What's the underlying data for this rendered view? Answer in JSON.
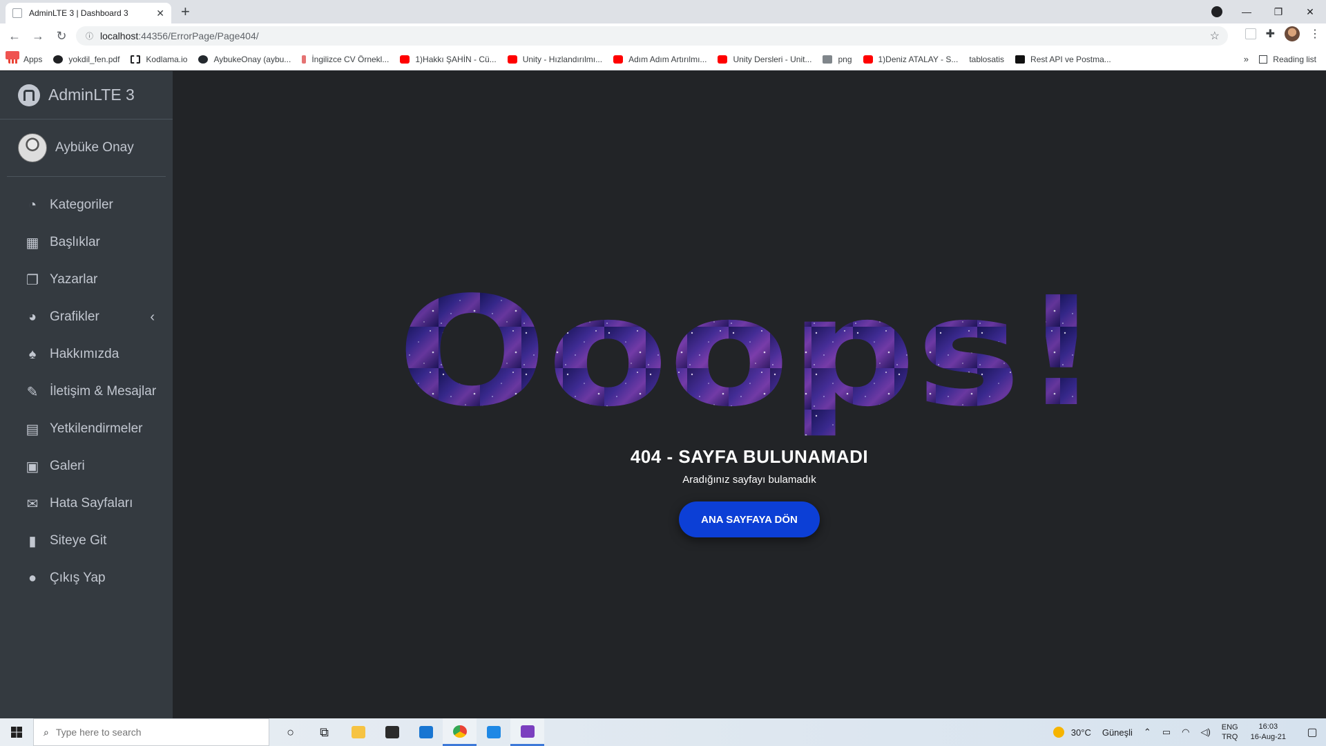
{
  "browser": {
    "tab_title": "AdminLTE 3 | Dashboard 3",
    "tab_close": "✕",
    "new_tab": "+",
    "url_host": "localhost",
    "url_path": ":44356/ErrorPage/Page404/",
    "window_controls": {
      "minimize": "—",
      "restore": "❐",
      "close": "✕"
    },
    "bookmarks": [
      {
        "label": "Apps",
        "icon": "apps-grid-icon"
      },
      {
        "label": "yokdil_fen.pdf",
        "icon": "pdf-icon"
      },
      {
        "label": "Kodlama.io",
        "icon": "kodlama-icon"
      },
      {
        "label": "AybukeOnay (aybu...",
        "icon": "github-icon"
      },
      {
        "label": "İngilizce CV Örnekl...",
        "icon": "cv-icon"
      },
      {
        "label": "1)Hakkı ŞAHİN - Cü...",
        "icon": "youtube-icon"
      },
      {
        "label": "Unity - Hızlandırılmı...",
        "icon": "youtube-icon"
      },
      {
        "label": "Adım Adım Artırılmı...",
        "icon": "youtube-icon"
      },
      {
        "label": "Unity Dersleri - Unit...",
        "icon": "youtube-icon"
      },
      {
        "label": "png",
        "icon": "png-icon"
      },
      {
        "label": "1)Deniz ATALAY - S...",
        "icon": "youtube-icon"
      },
      {
        "label": "tablosatis",
        "icon": "tablosatis-icon"
      },
      {
        "label": "Rest API ve Postma...",
        "icon": "api-icon"
      }
    ],
    "bookmarks_more": "»",
    "reading_list": "Reading list"
  },
  "sidebar": {
    "brand": "AdminLTE 3",
    "user_name": "Aybüke Onay",
    "items": [
      {
        "label": "Kategoriler",
        "icon": "tachometer-icon",
        "glyph": "◔"
      },
      {
        "label": "Başlıklar",
        "icon": "grid-icon",
        "glyph": "▦"
      },
      {
        "label": "Yazarlar",
        "icon": "copy-icon",
        "glyph": "❐"
      },
      {
        "label": "Grafikler",
        "icon": "pie-chart-icon",
        "glyph": "◕",
        "caret": "‹"
      },
      {
        "label": "Hakkımızda",
        "icon": "tree-icon",
        "glyph": "♠"
      },
      {
        "label": "İletişim & Mesajlar",
        "icon": "edit-icon",
        "glyph": "✎"
      },
      {
        "label": "Yetkilendirmeler",
        "icon": "calendar-icon",
        "glyph": "▤"
      },
      {
        "label": "Galeri",
        "icon": "image-icon",
        "glyph": "▣"
      },
      {
        "label": "Hata Sayfaları",
        "icon": "envelope-icon",
        "glyph": "✉"
      },
      {
        "label": "Siteye Git",
        "icon": "book-icon",
        "glyph": "▮"
      },
      {
        "label": "Çıkış Yap",
        "icon": "apple-icon",
        "glyph": "●"
      }
    ]
  },
  "main": {
    "oops_text": "Ooops!",
    "error_title": "404 - SAYFA BULUNAMADI",
    "error_subtitle": "Aradığınız sayfayı bulamadık",
    "home_button": "ANA SAYFAYA DÖN"
  },
  "taskbar": {
    "search_placeholder": "Type here to search",
    "temperature": "30°C",
    "weather": "Güneşli",
    "lang_top": "ENG",
    "lang_bottom": "TRQ",
    "time": "16:03",
    "date": "16-Aug-21"
  }
}
